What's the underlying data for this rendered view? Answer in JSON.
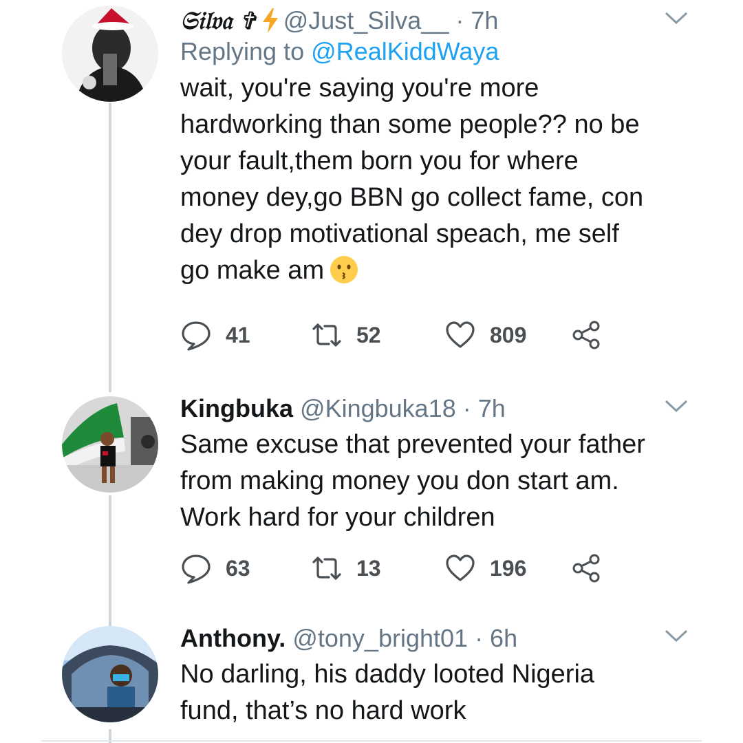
{
  "tweets": [
    {
      "display_name": "𝔖𝔦𝔩𝔳𝔞 ✞",
      "handle": "@Just_Silva__",
      "time": "· 7h",
      "replying_prefix": "Replying to",
      "replying_to": "@RealKiddWaya",
      "text_lines": [
        "wait, you're saying you're more",
        "hardworking than some people?? no be",
        "your fault,them born you for where",
        "money dey,go BBN go collect fame, con",
        "dey drop motivational speach, me self",
        "go make am"
      ],
      "emoji": "kissing-face",
      "replies": "41",
      "retweets": "52",
      "likes": "809"
    },
    {
      "display_name": "Kingbuka",
      "handle": "@Kingbuka18",
      "time": "· 7h",
      "text_lines": [
        "Same excuse that prevented your father",
        "from making money you don start am.",
        "Work hard for your children"
      ],
      "replies": "63",
      "retweets": "13",
      "likes": "196"
    },
    {
      "display_name": "Anthony.",
      "handle": "@tony_bright01",
      "time": "· 6h",
      "text_lines": [
        "No darling, his daddy looted Nigeria",
        "fund, that’s no hard work"
      ]
    }
  ],
  "icons": {
    "reply": "speech-bubble-icon",
    "retweet": "retweet-icon",
    "like": "heart-icon",
    "share": "share-icon",
    "more": "chevron-down-icon",
    "verified_bolt": "lightning-bolt-icon"
  },
  "colors": {
    "link": "#1da1f2",
    "muted": "#657786",
    "text": "#14171a",
    "bolt": "#f5a623",
    "thread_line": "#ccd6dd"
  }
}
